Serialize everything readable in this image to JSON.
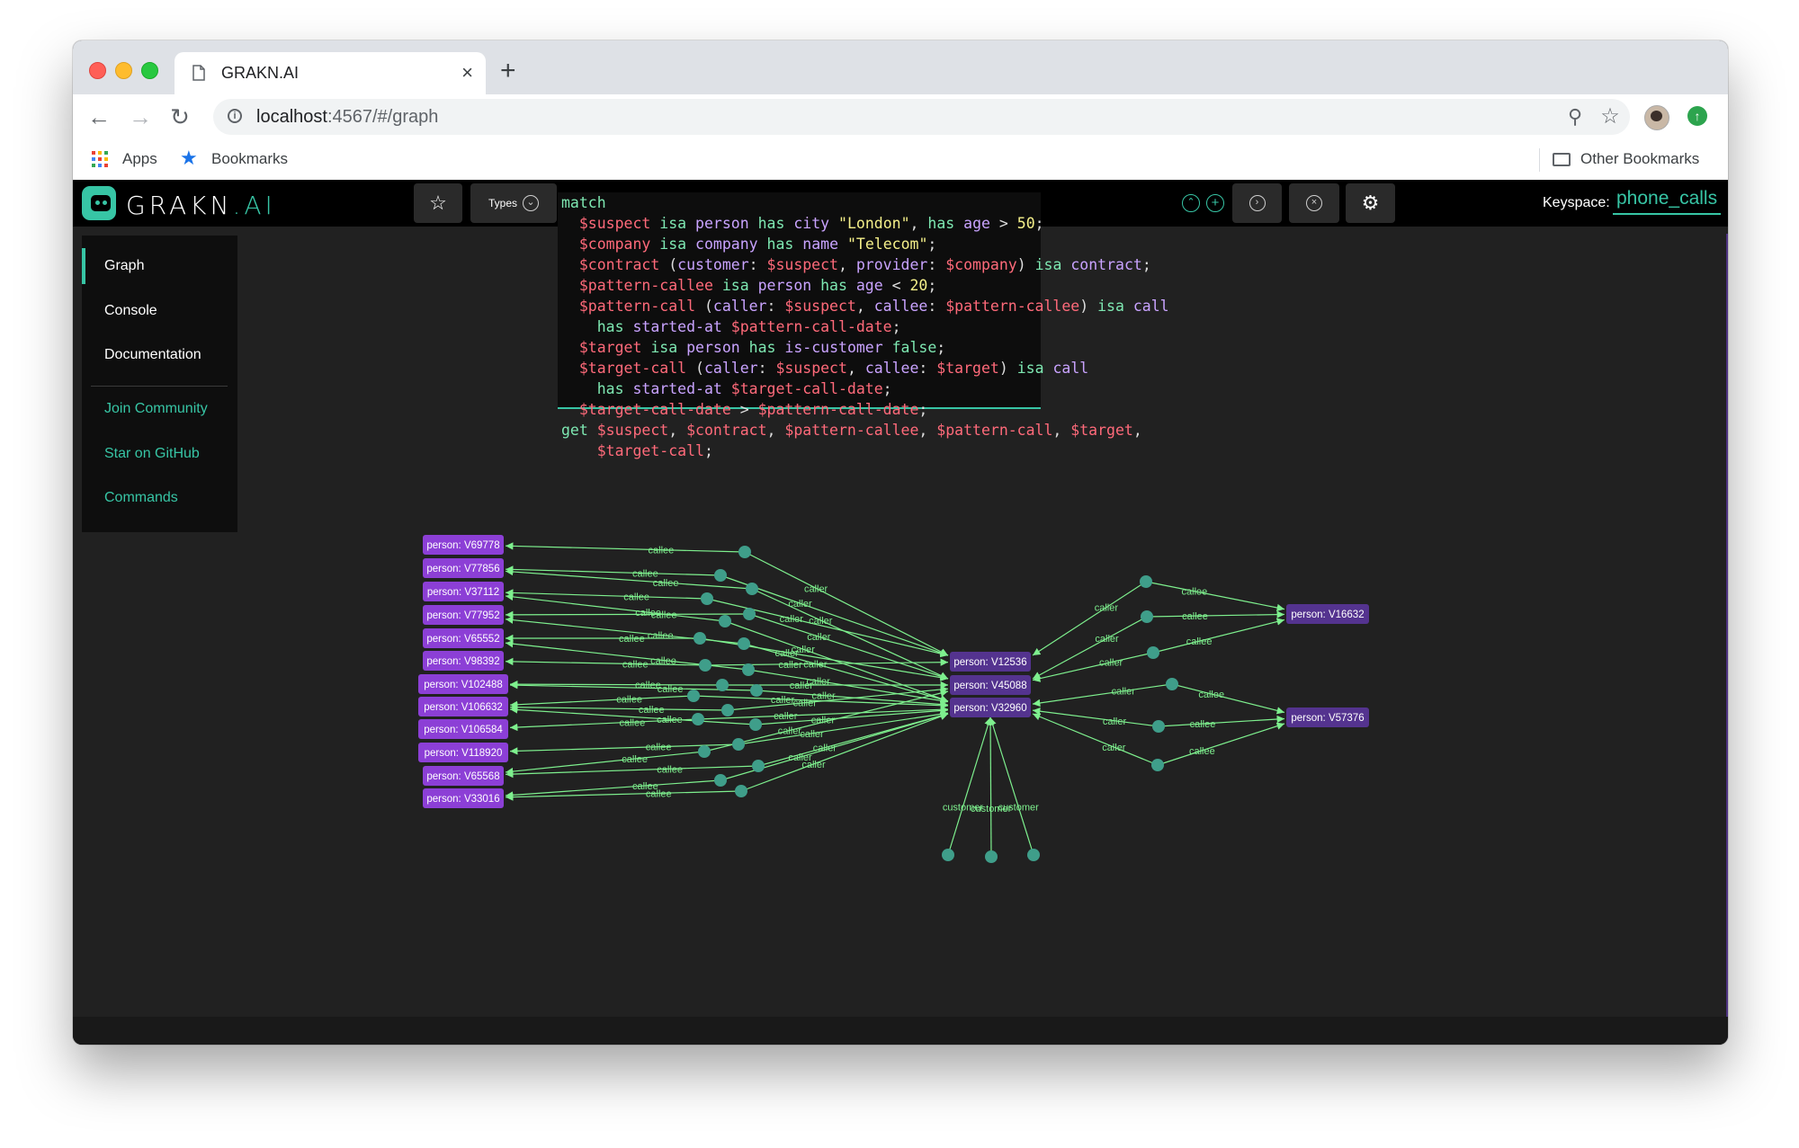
{
  "browser": {
    "tab_title": "GRAKN.AI",
    "tab_close": "×",
    "new_tab": "+",
    "url_host": "localhost",
    "url_path": ":4567/#/graph",
    "bookmarks": {
      "apps": "Apps",
      "bookmarks": "Bookmarks",
      "other": "Other Bookmarks"
    },
    "icons": [
      "back-icon",
      "forward-icon",
      "reload-icon",
      "info-icon",
      "zoom-icon",
      "bookmark-star-icon",
      "profile-avatar",
      "extension-icon"
    ]
  },
  "app": {
    "logo_text": "GRAKN",
    "logo_suffix": ".AI",
    "types_label": "Types",
    "keyspace_label": "Keyspace:",
    "keyspace_value": "phone_calls",
    "colors": {
      "accent": "#37c5a5",
      "edge": "#7ef08e",
      "entity": "#8c3fd6",
      "relation": "#3f9e8a",
      "background": "#212121"
    }
  },
  "sidebar": {
    "items": [
      {
        "label": "Graph",
        "active": true
      },
      {
        "label": "Console"
      },
      {
        "label": "Documentation"
      },
      {
        "label": "Join Community",
        "link": true
      },
      {
        "label": "Star on GitHub",
        "link": true
      },
      {
        "label": "Commands",
        "link": true
      }
    ]
  },
  "query": {
    "lines": [
      [
        [
          "kw",
          "match"
        ]
      ],
      [
        [
          "t",
          "  "
        ],
        [
          "var",
          "$suspect"
        ],
        [
          "t",
          " "
        ],
        [
          "kw",
          "isa"
        ],
        [
          "t",
          " "
        ],
        [
          "lbl",
          "person"
        ],
        [
          "t",
          " "
        ],
        [
          "kw",
          "has"
        ],
        [
          "t",
          " "
        ],
        [
          "lbl",
          "city"
        ],
        [
          "t",
          " "
        ],
        [
          "str",
          "\"London\""
        ],
        [
          "t",
          ", "
        ],
        [
          "kw",
          "has"
        ],
        [
          "t",
          " "
        ],
        [
          "lbl",
          "age"
        ],
        [
          "t",
          " > "
        ],
        [
          "num",
          "50"
        ],
        [
          "t",
          ";"
        ]
      ],
      [
        [
          "t",
          "  "
        ],
        [
          "var",
          "$company"
        ],
        [
          "t",
          " "
        ],
        [
          "kw",
          "isa"
        ],
        [
          "t",
          " "
        ],
        [
          "lbl",
          "company"
        ],
        [
          "t",
          " "
        ],
        [
          "kw",
          "has"
        ],
        [
          "t",
          " "
        ],
        [
          "lbl",
          "name"
        ],
        [
          "t",
          " "
        ],
        [
          "str",
          "\"Telecom\""
        ],
        [
          "t",
          ";"
        ]
      ],
      [
        [
          "t",
          "  "
        ],
        [
          "var",
          "$contract"
        ],
        [
          "t",
          " ("
        ],
        [
          "lbl",
          "customer"
        ],
        [
          "t",
          ": "
        ],
        [
          "var",
          "$suspect"
        ],
        [
          "t",
          ", "
        ],
        [
          "lbl",
          "provider"
        ],
        [
          "t",
          ": "
        ],
        [
          "var",
          "$company"
        ],
        [
          "t",
          ") "
        ],
        [
          "kw",
          "isa"
        ],
        [
          "t",
          " "
        ],
        [
          "lbl",
          "contract"
        ],
        [
          "t",
          ";"
        ]
      ],
      [
        [
          "t",
          "  "
        ],
        [
          "var",
          "$pattern-callee"
        ],
        [
          "t",
          " "
        ],
        [
          "kw",
          "isa"
        ],
        [
          "t",
          " "
        ],
        [
          "lbl",
          "person"
        ],
        [
          "t",
          " "
        ],
        [
          "kw",
          "has"
        ],
        [
          "t",
          " "
        ],
        [
          "lbl",
          "age"
        ],
        [
          "t",
          " < "
        ],
        [
          "num",
          "20"
        ],
        [
          "t",
          ";"
        ]
      ],
      [
        [
          "t",
          "  "
        ],
        [
          "var",
          "$pattern-call"
        ],
        [
          "t",
          " ("
        ],
        [
          "lbl",
          "caller"
        ],
        [
          "t",
          ": "
        ],
        [
          "var",
          "$suspect"
        ],
        [
          "t",
          ", "
        ],
        [
          "lbl",
          "callee"
        ],
        [
          "t",
          ": "
        ],
        [
          "var",
          "$pattern-callee"
        ],
        [
          "t",
          ") "
        ],
        [
          "kw",
          "isa"
        ],
        [
          "t",
          " "
        ],
        [
          "lbl",
          "call"
        ]
      ],
      [
        [
          "t",
          "    "
        ],
        [
          "kw",
          "has"
        ],
        [
          "t",
          " "
        ],
        [
          "lbl",
          "started-at"
        ],
        [
          "t",
          " "
        ],
        [
          "var",
          "$pattern-call-date"
        ],
        [
          "t",
          ";"
        ]
      ],
      [
        [
          "t",
          "  "
        ],
        [
          "var",
          "$target"
        ],
        [
          "t",
          " "
        ],
        [
          "kw",
          "isa"
        ],
        [
          "t",
          " "
        ],
        [
          "lbl",
          "person"
        ],
        [
          "t",
          " "
        ],
        [
          "kw",
          "has"
        ],
        [
          "t",
          " "
        ],
        [
          "lbl",
          "is-customer"
        ],
        [
          "t",
          " "
        ],
        [
          "kw",
          "false"
        ],
        [
          "t",
          ";"
        ]
      ],
      [
        [
          "t",
          "  "
        ],
        [
          "var",
          "$target-call"
        ],
        [
          "t",
          " ("
        ],
        [
          "lbl",
          "caller"
        ],
        [
          "t",
          ": "
        ],
        [
          "var",
          "$suspect"
        ],
        [
          "t",
          ", "
        ],
        [
          "lbl",
          "callee"
        ],
        [
          "t",
          ": "
        ],
        [
          "var",
          "$target"
        ],
        [
          "t",
          ") "
        ],
        [
          "kw",
          "isa"
        ],
        [
          "t",
          " "
        ],
        [
          "lbl",
          "call"
        ]
      ],
      [
        [
          "t",
          "    "
        ],
        [
          "kw",
          "has"
        ],
        [
          "t",
          " "
        ],
        [
          "lbl",
          "started-at"
        ],
        [
          "t",
          " "
        ],
        [
          "var",
          "$target-call-date"
        ],
        [
          "t",
          ";"
        ]
      ],
      [
        [
          "t",
          "  "
        ],
        [
          "var",
          "$target-call-date"
        ],
        [
          "t",
          " > "
        ],
        [
          "var",
          "$pattern-call-date"
        ],
        [
          "t",
          ";"
        ]
      ],
      [
        [
          "kw",
          "get"
        ],
        [
          "t",
          " "
        ],
        [
          "var",
          "$suspect"
        ],
        [
          "t",
          ", "
        ],
        [
          "var",
          "$contract"
        ],
        [
          "t",
          ", "
        ],
        [
          "var",
          "$pattern-callee"
        ],
        [
          "t",
          ", "
        ],
        [
          "var",
          "$pattern-call"
        ],
        [
          "t",
          ", "
        ],
        [
          "var",
          "$target"
        ],
        [
          "t",
          ","
        ]
      ],
      [
        [
          "t",
          "    "
        ],
        [
          "var",
          "$target-call"
        ],
        [
          "t",
          ";"
        ]
      ]
    ]
  },
  "graph": {
    "entities": [
      {
        "id": "L1",
        "label": "person: V69778"
      },
      {
        "id": "L2",
        "label": "person: V77856"
      },
      {
        "id": "L3",
        "label": "person: V37112"
      },
      {
        "id": "L4",
        "label": "person: V77952"
      },
      {
        "id": "L5",
        "label": "person: V65552"
      },
      {
        "id": "L6",
        "label": "person: V98392"
      },
      {
        "id": "L7",
        "label": "person: V102488"
      },
      {
        "id": "L8",
        "label": "person: V106632"
      },
      {
        "id": "L9",
        "label": "person: V106584"
      },
      {
        "id": "L10",
        "label": "person: V118920"
      },
      {
        "id": "L11",
        "label": "person: V65568"
      },
      {
        "id": "L12",
        "label": "person: V33016"
      },
      {
        "id": "S1",
        "label": "person: V12536"
      },
      {
        "id": "S2",
        "label": "person: V45088"
      },
      {
        "id": "S3",
        "label": "person: V32960"
      },
      {
        "id": "R1",
        "label": "person: V16632"
      },
      {
        "id": "R2",
        "label": "person: V57376"
      }
    ],
    "edge_labels": {
      "caller": "caller",
      "callee": "callee",
      "customer": "customer"
    }
  }
}
